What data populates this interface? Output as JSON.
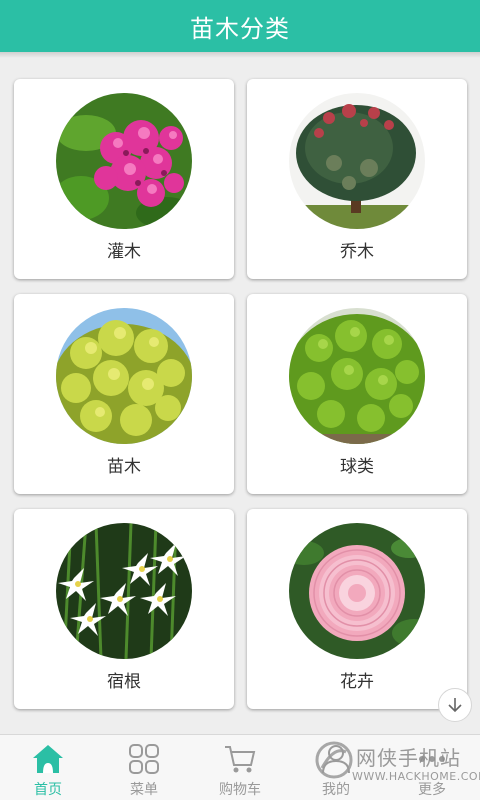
{
  "header": {
    "title": "苗木分类"
  },
  "categories": [
    {
      "label": "灌木",
      "image": "pink-spirea-flowers"
    },
    {
      "label": "乔木",
      "image": "red-tip-tree"
    },
    {
      "label": "苗木",
      "image": "yellow-green-shrub"
    },
    {
      "label": "球类",
      "image": "green-ball-shrub"
    },
    {
      "label": "宿根",
      "image": "white-zephyr-lilies"
    },
    {
      "label": "花卉",
      "image": "pink-camellia"
    }
  ],
  "scroll": {
    "icon": "arrow-down-icon"
  },
  "tabbar": {
    "tabs": [
      {
        "label": "首页",
        "icon": "home-icon",
        "active": true
      },
      {
        "label": "菜单",
        "icon": "grid-menu-icon",
        "active": false
      },
      {
        "label": "购物车",
        "icon": "cart-icon",
        "active": false
      },
      {
        "label": "我的",
        "icon": "user-icon",
        "active": false
      },
      {
        "label": "更多",
        "icon": "more-icon",
        "active": false
      }
    ]
  },
  "watermark": {
    "text": "网侠手机站",
    "url": "WWW.HACKHOME.COM"
  },
  "colors": {
    "accent": "#2bbfa5",
    "inactive": "#9a9a9a",
    "background": "#eeeeee"
  }
}
